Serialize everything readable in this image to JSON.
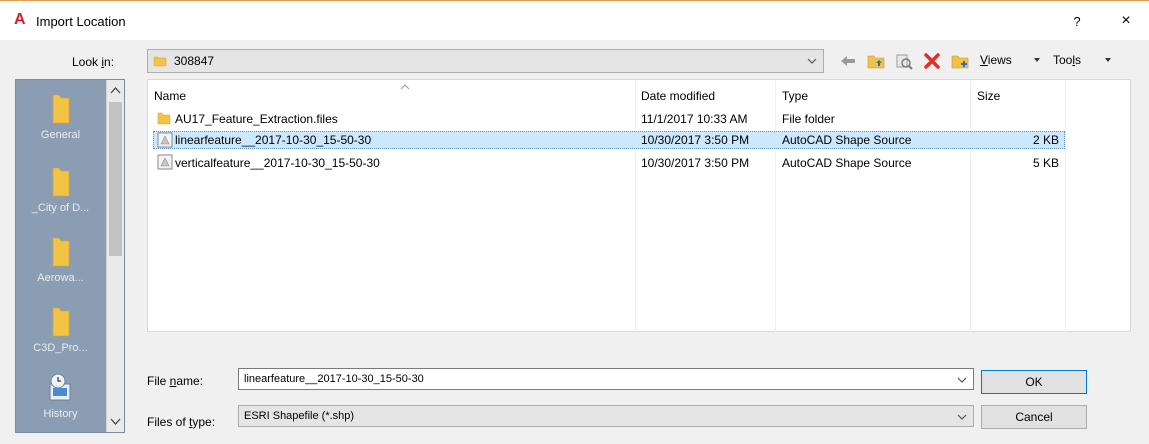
{
  "window": {
    "title": "Import Location",
    "help_label": "?",
    "close_label": "×",
    "brand_color": "#d21f27"
  },
  "lookin": {
    "label_pre": "Look ",
    "label_u": "i",
    "label_post": "n:",
    "value": "308847"
  },
  "toolbar": {
    "views_u": "V",
    "views_post": "iews",
    "tools_pre": "Too",
    "tools_u": "l",
    "tools_post": "s"
  },
  "places": [
    {
      "label": "General",
      "icon": "folder-icon"
    },
    {
      "label": "_City of D...",
      "icon": "folder-icon"
    },
    {
      "label": "Aerowa...",
      "icon": "folder-icon"
    },
    {
      "label": "C3D_Pro...",
      "icon": "folder-icon"
    },
    {
      "label": "History",
      "icon": "history-icon"
    }
  ],
  "columns": {
    "name": "Name",
    "date": "Date modified",
    "type": "Type",
    "size": "Size"
  },
  "files": [
    {
      "name": "AU17_Feature_Extraction.files",
      "date": "11/1/2017 10:33 AM",
      "type": "File folder",
      "size": "",
      "icon": "folder-icon",
      "selected": false
    },
    {
      "name": "linearfeature__2017-10-30_15-50-30",
      "date": "10/30/2017 3:50 PM",
      "type": "AutoCAD Shape Source",
      "size": "2 KB",
      "icon": "shape-file-icon",
      "selected": true
    },
    {
      "name": "verticalfeature__2017-10-30_15-50-30",
      "date": "10/30/2017 3:50 PM",
      "type": "AutoCAD Shape Source",
      "size": "5 KB",
      "icon": "shape-file-icon",
      "selected": false
    }
  ],
  "filename": {
    "label_pre": "File ",
    "label_u": "n",
    "label_post": "ame:",
    "value": "linearfeature__2017-10-30_15-50-30"
  },
  "filetype": {
    "label_pre": "Files of ",
    "label_u": "t",
    "label_post": "ype:",
    "value": "ESRI Shapefile  (*.shp)"
  },
  "buttons": {
    "ok": "OK",
    "cancel": "Cancel"
  },
  "colors": {
    "places_bg": "#8b9db3",
    "selection": "#cce8ff",
    "delete_red": "#e0302c"
  }
}
